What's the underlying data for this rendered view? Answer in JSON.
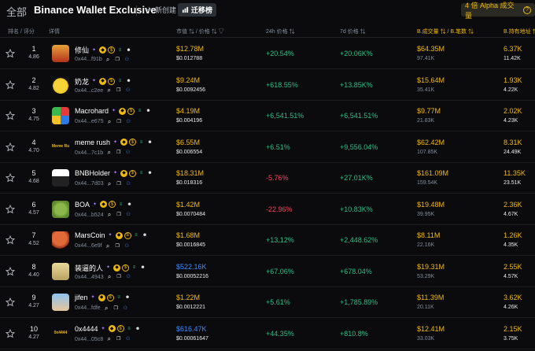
{
  "topbar": {
    "all_label": "全部",
    "title": "Binance Wallet Exclusive",
    "new_label": "新创建",
    "migrate_label": "迁移榜",
    "alpha_label": "4 倍 Alpha 成交量"
  },
  "header": {
    "rank": "排名 / 评分",
    "details": "详情",
    "mcap": "市值",
    "price": "价格",
    "h24": "24h 价格",
    "d7": "7d 价格",
    "vol": "B.成交量",
    "count": "B.笔数",
    "holders": "B.持有地址"
  },
  "colors": {
    "accent": "#f0b90b",
    "up": "#2ebd85",
    "down": "#f6465d",
    "blue": "#3d8bff"
  },
  "rows": [
    {
      "rank": "1",
      "score": "4.86",
      "name": "修仙",
      "addr": "0x44...f91b",
      "mcap": "$12.78M",
      "price": "$0.012788",
      "h24": "+20.54%",
      "d7": "+20.06K%",
      "vol": "$64.35M",
      "count": "97.41K",
      "hold": "6.37K",
      "hold2": "11.42K",
      "up24": true,
      "blue": false
    },
    {
      "rank": "2",
      "score": "4.82",
      "name": "奶龙",
      "addr": "0x44...c2ee",
      "mcap": "$9.24M",
      "price": "$0.0092456",
      "h24": "+618.55%",
      "d7": "+13.85K%",
      "vol": "$15.64M",
      "count": "35.41K",
      "hold": "1.93K",
      "hold2": "4.22K",
      "up24": true,
      "blue": false
    },
    {
      "rank": "3",
      "score": "4.75",
      "name": "Macrohard",
      "addr": "0x44...e675",
      "mcap": "$4.19M",
      "price": "$0.004196",
      "h24": "+6,541.51%",
      "d7": "+6,541.51%",
      "vol": "$9.77M",
      "count": "21.83K",
      "hold": "2.02K",
      "hold2": "4.23K",
      "up24": true,
      "blue": false
    },
    {
      "rank": "4",
      "score": "4.70",
      "name": "meme rush",
      "addr": "0x44...7c1b",
      "mcap": "$6.55M",
      "price": "$0.006554",
      "h24": "+6.51%",
      "d7": "+9,556.04%",
      "vol": "$62.42M",
      "count": "107.85K",
      "hold": "8.31K",
      "hold2": "24.49K",
      "up24": true,
      "blue": false
    },
    {
      "rank": "5",
      "score": "4.68",
      "name": "BNBHolder",
      "addr": "0x44...7d03",
      "mcap": "$18.31M",
      "price": "$0.018316",
      "h24": "-5.76%",
      "d7": "+27.01K%",
      "vol": "$161.09M",
      "count": "159.54K",
      "hold": "11.35K",
      "hold2": "23.51K",
      "up24": false,
      "blue": false
    },
    {
      "rank": "6",
      "score": "4.57",
      "name": "BOA",
      "addr": "0x44...b524",
      "mcap": "$1.42M",
      "price": "$0.0070484",
      "h24": "-22.96%",
      "d7": "+10.83K%",
      "vol": "$19.48M",
      "count": "39.95K",
      "hold": "2.36K",
      "hold2": "4.67K",
      "up24": false,
      "blue": false
    },
    {
      "rank": "7",
      "score": "4.52",
      "name": "MarsCoin",
      "addr": "0x44...6e9f",
      "mcap": "$1.68M",
      "price": "$0.0016845",
      "h24": "+13.12%",
      "d7": "+2,448.62%",
      "vol": "$8.11M",
      "count": "22.16K",
      "hold": "1.26K",
      "hold2": "4.35K",
      "up24": true,
      "blue": false
    },
    {
      "rank": "8",
      "score": "4.40",
      "name": "装逼的人",
      "addr": "0x44...4943",
      "mcap": "$522.16K",
      "price": "$0.00052216",
      "h24": "+67.06%",
      "d7": "+678.04%",
      "vol": "$19.31M",
      "count": "53.29K",
      "hold": "2.55K",
      "hold2": "4.57K",
      "up24": true,
      "blue": true
    },
    {
      "rank": "9",
      "score": "4.27",
      "name": "jifen",
      "addr": "0x44...fdfe",
      "mcap": "$1.22M",
      "price": "$0.0012221",
      "h24": "+5.61%",
      "d7": "+1,785.89%",
      "vol": "$11.39M",
      "count": "20.11K",
      "hold": "3.62K",
      "hold2": "4.26K",
      "up24": true,
      "blue": false
    },
    {
      "rank": "10",
      "score": "4.27",
      "name": "0x4444",
      "addr": "0x44...05c8",
      "mcap": "$616.47K",
      "price": "$0.00061647",
      "h24": "+44.35%",
      "d7": "+810.8%",
      "vol": "$12.41M",
      "count": "33.03K",
      "hold": "2.15K",
      "hold2": "3.75K",
      "up24": true,
      "blue": true
    }
  ]
}
